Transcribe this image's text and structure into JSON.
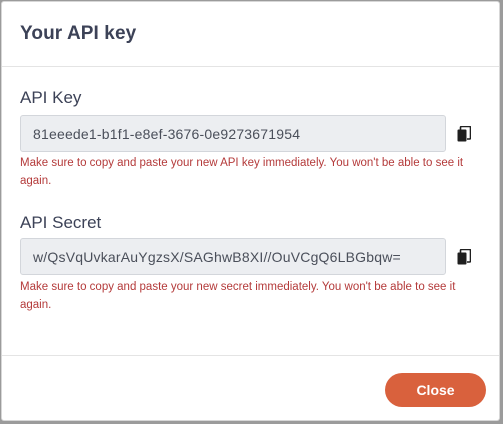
{
  "modal": {
    "title": "Your API key"
  },
  "api_key": {
    "label": "API Key",
    "value": "81eeede1-b1f1-e8ef-3676-0e9273671954",
    "warning": "Make sure to copy and paste your new API key immediately. You won't be able to see it again."
  },
  "api_secret": {
    "label": "API Secret",
    "value": "w/QsVqUvkarAuYgzsX/SAGhwB8XI//OuVCgQ6LBGbqw=",
    "warning": "Make sure to copy and paste your new secret immediately. You won't be able to see it again."
  },
  "footer": {
    "close_label": "Close"
  },
  "icons": {
    "copy": "copy-icon"
  },
  "colors": {
    "close_button": "#d9613d",
    "warning_text": "#b43a3a",
    "title_text": "#3c4257"
  }
}
